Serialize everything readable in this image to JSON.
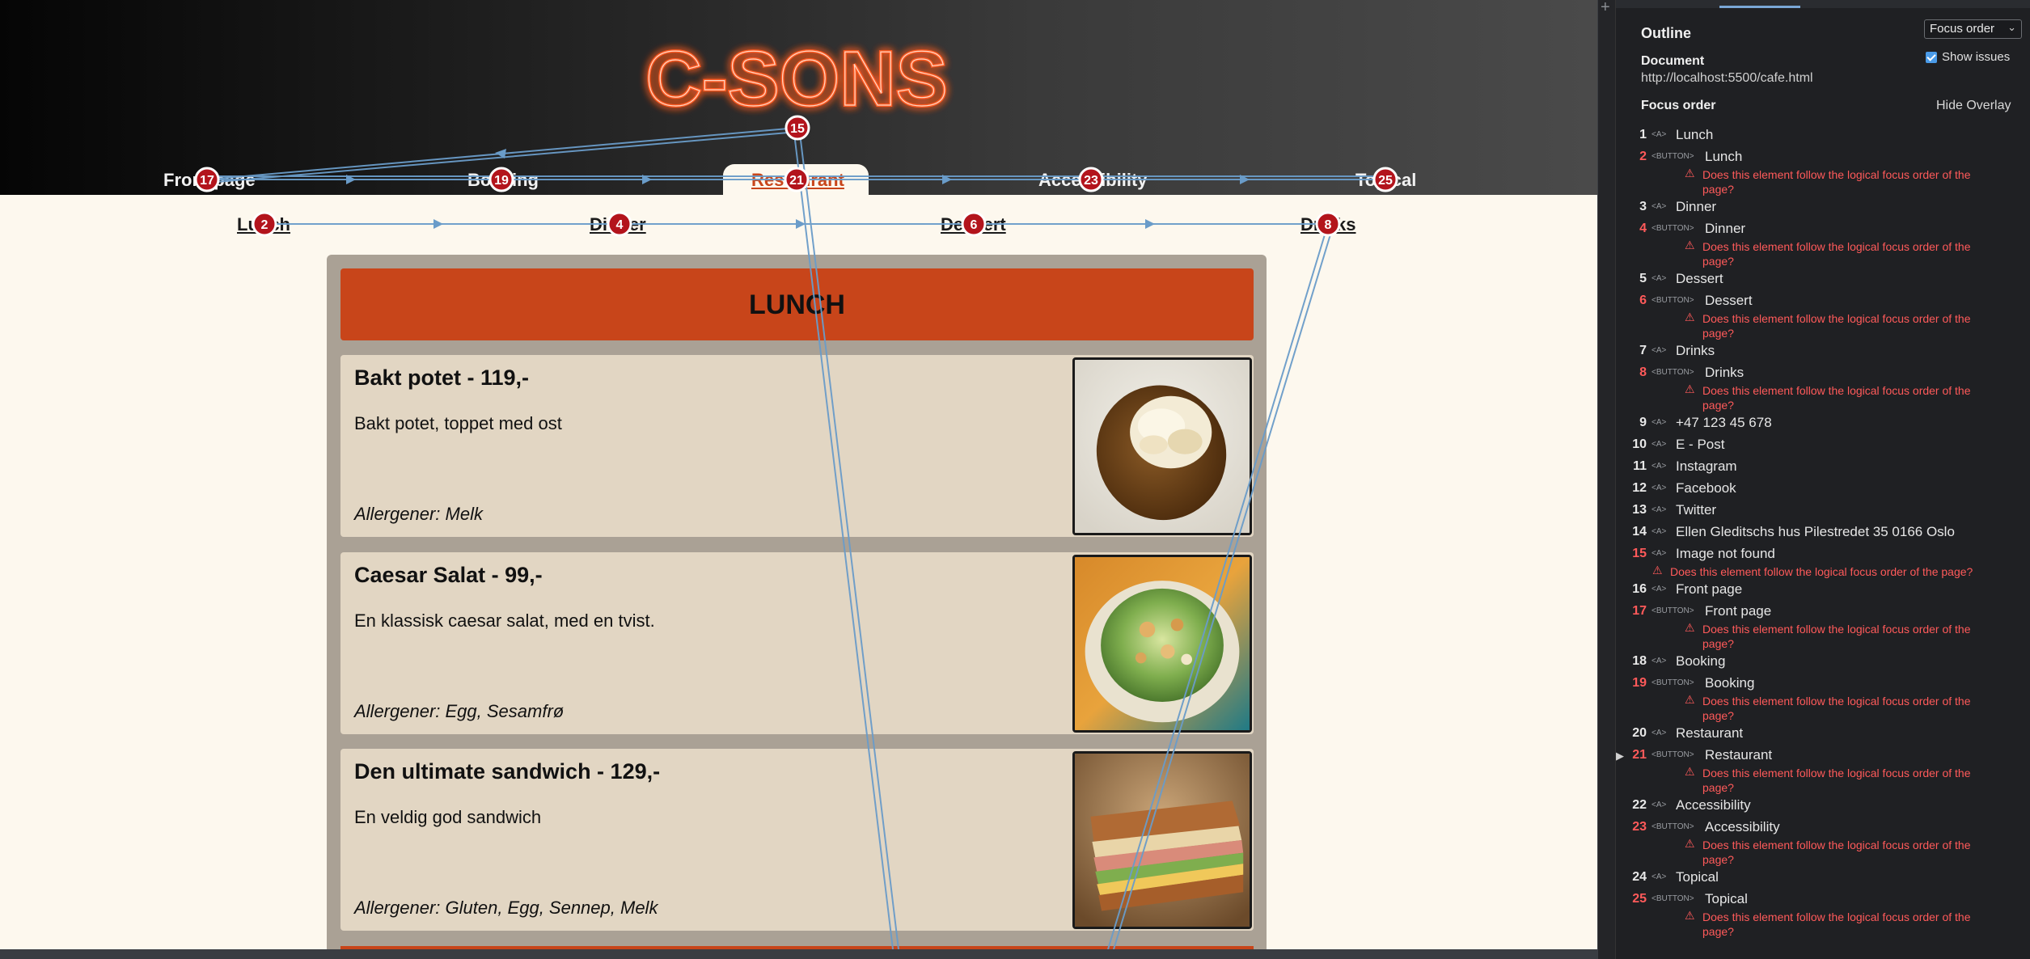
{
  "site": {
    "logo_text": "C-SONS",
    "nav": [
      "Front page",
      "Booking",
      "Restaurant",
      "Accessibility",
      "Topical"
    ],
    "subnav": [
      "Lunch",
      "Dinner",
      "Dessert",
      "Drinks"
    ],
    "menu_title": "LUNCH",
    "items": [
      {
        "title": "Bakt potet - 119,-",
        "description": "Bakt potet, toppet med ost",
        "allergens": "Allergener: Melk",
        "photo": "baked-potato"
      },
      {
        "title": "Caesar Salat - 99,-",
        "description": "En klassisk caesar salat, med en tvist.",
        "allergens": "Allergener: Egg, Sesamfrø",
        "photo": "caesar-salad"
      },
      {
        "title": "Den ultimate sandwich - 129,-",
        "description": "En veldig god sandwich",
        "allergens": "Allergener: Gluten, Egg, Sennep, Melk",
        "photo": "sandwich"
      }
    ]
  },
  "overlay": {
    "badges": [
      "15",
      "17",
      "19",
      "21",
      "23",
      "25",
      "2",
      "4",
      "6",
      "8"
    ]
  },
  "devtools": {
    "panel_title": "Outline",
    "mode_select": "Focus order",
    "show_issues_label": "Show issues",
    "show_issues_checked": true,
    "document_label": "Document",
    "document_url": "http://localhost:5500/cafe.html",
    "focus_order_label": "Focus order",
    "hide_overlay_label": "Hide Overlay",
    "issue_message": "Does this element follow the logical focus order of the page?",
    "issue_message_line1": "Does this element follow the logical focus order of the",
    "issue_message_line2": "page?",
    "rows": [
      {
        "num": "1",
        "tag": "<A>",
        "name": "Lunch"
      },
      {
        "num": "2",
        "tag": "<BUTTON>",
        "name": "Lunch",
        "issue": true
      },
      {
        "num": "3",
        "tag": "<A>",
        "name": "Dinner"
      },
      {
        "num": "4",
        "tag": "<BUTTON>",
        "name": "Dinner",
        "issue": true
      },
      {
        "num": "5",
        "tag": "<A>",
        "name": "Dessert"
      },
      {
        "num": "6",
        "tag": "<BUTTON>",
        "name": "Dessert",
        "issue": true
      },
      {
        "num": "7",
        "tag": "<A>",
        "name": "Drinks"
      },
      {
        "num": "8",
        "tag": "<BUTTON>",
        "name": "Drinks",
        "issue": true
      },
      {
        "num": "9",
        "tag": "<A>",
        "name": "+47 123 45 678"
      },
      {
        "num": "10",
        "tag": "<A>",
        "name": "E - Post"
      },
      {
        "num": "11",
        "tag": "<A>",
        "name": "Instagram"
      },
      {
        "num": "12",
        "tag": "<A>",
        "name": "Facebook"
      },
      {
        "num": "13",
        "tag": "<A>",
        "name": "Twitter"
      },
      {
        "num": "14",
        "tag": "<A>",
        "name": "Ellen Gleditschs hus Pilestredet 35 0166 Oslo"
      },
      {
        "num": "15",
        "tag": "<A>",
        "name": "Image not found",
        "issue": true
      },
      {
        "num": "16",
        "tag": "<A>",
        "name": "Front page"
      },
      {
        "num": "17",
        "tag": "<BUTTON>",
        "name": "Front page",
        "issue": true
      },
      {
        "num": "18",
        "tag": "<A>",
        "name": "Booking"
      },
      {
        "num": "19",
        "tag": "<BUTTON>",
        "name": "Booking",
        "issue": true
      },
      {
        "num": "20",
        "tag": "<A>",
        "name": "Restaurant"
      },
      {
        "num": "21",
        "tag": "<BUTTON>",
        "name": "Restaurant",
        "issue": true,
        "selected": true
      },
      {
        "num": "22",
        "tag": "<A>",
        "name": "Accessibility"
      },
      {
        "num": "23",
        "tag": "<BUTTON>",
        "name": "Accessibility",
        "issue": true
      },
      {
        "num": "24",
        "tag": "<A>",
        "name": "Topical"
      },
      {
        "num": "25",
        "tag": "<BUTTON>",
        "name": "Topical",
        "issue": true
      }
    ]
  }
}
